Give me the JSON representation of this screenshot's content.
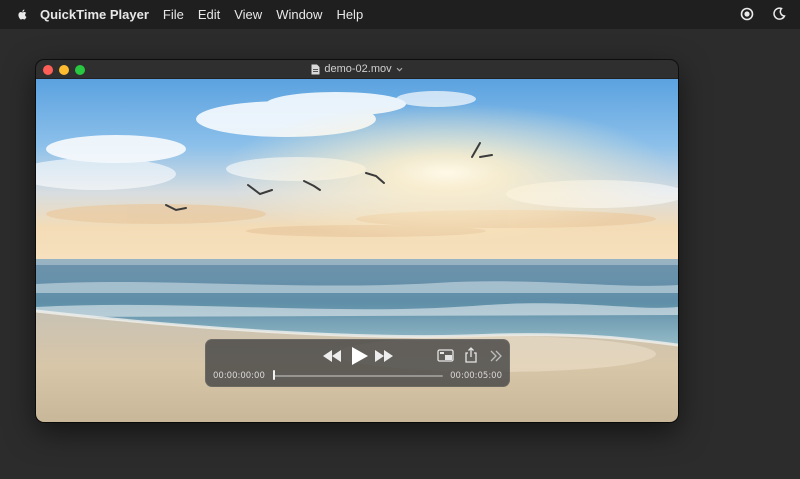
{
  "menubar": {
    "apple_icon": "apple-logo-icon",
    "app_name": "QuickTime Player",
    "items": [
      "File",
      "Edit",
      "View",
      "Window",
      "Help"
    ],
    "status_icons": [
      "record-icon",
      "moon-icon"
    ]
  },
  "window": {
    "title": "demo-02.mov",
    "title_icon": "document-icon",
    "controls": {
      "current_time": "00:00:00:00",
      "duration": "00:00:05:00",
      "progress": 0.0,
      "buttons": [
        "rewind",
        "play",
        "fast-forward",
        "picture-in-picture",
        "share",
        "more"
      ]
    }
  },
  "colors": {
    "close": "#ff5f57",
    "minimize": "#febc2e",
    "maximize": "#28c840",
    "hud_background": "#464646"
  }
}
